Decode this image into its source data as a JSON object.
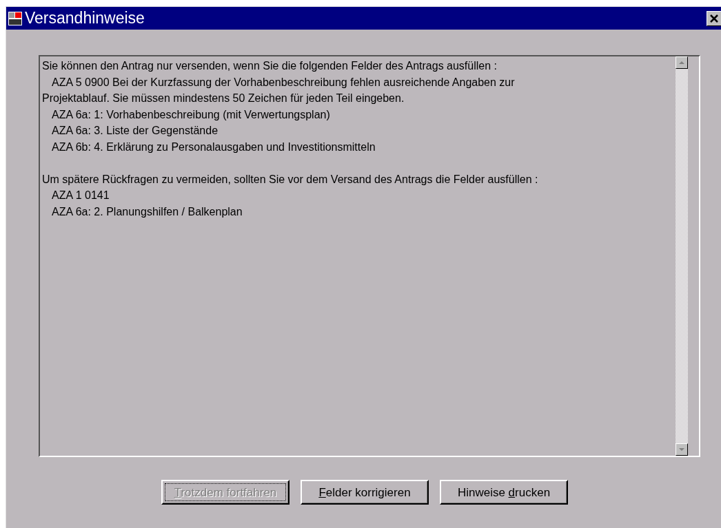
{
  "window": {
    "title": "Versandhinweise"
  },
  "message": {
    "sections": [
      {
        "lines": [
          {
            "text": "Sie können den Antrag nur versenden, wenn Sie die folgenden Felder des Antrags ausfüllen :",
            "indent": false
          },
          {
            "text": "AZA 5 0900 Bei der Kurzfassung der Vorhabenbeschreibung fehlen ausreichende Angaben zur",
            "indent": true
          },
          {
            "text": "Projektablauf. Sie müssen mindestens 50 Zeichen für jeden Teil eingeben.",
            "indent": false
          },
          {
            "text": "AZA 6a: 1: Vorhabenbeschreibung (mit Verwertungsplan)",
            "indent": true
          },
          {
            "text": "AZA 6a: 3. Liste der Gegenstände",
            "indent": true
          },
          {
            "text": "AZA 6b: 4. Erklärung zu Personalausgaben und Investitionsmitteln",
            "indent": true
          }
        ]
      },
      {
        "lines": [
          {
            "text": "Um spätere Rückfragen zu vermeiden, sollten Sie vor dem Versand des Antrags die Felder ausfüllen :",
            "indent": false
          },
          {
            "text": "AZA 1 0141",
            "indent": true
          },
          {
            "text": "AZA 6a: 2. Planungshilfen / Balkenplan",
            "indent": true
          }
        ]
      }
    ]
  },
  "buttons": [
    {
      "label_parts": [
        {
          "text": "T",
          "underlined": true
        },
        {
          "text": "rotzdem fortfahren",
          "underlined": false
        }
      ],
      "disabled": true,
      "focused": true
    },
    {
      "label_parts": [
        {
          "text": "F",
          "underlined": true
        },
        {
          "text": "elder korrigieren",
          "underlined": false
        }
      ],
      "disabled": false,
      "focused": false
    },
    {
      "label_parts": [
        {
          "text": "Hinweise ",
          "underlined": false
        },
        {
          "text": "d",
          "underlined": true
        },
        {
          "text": "rucken",
          "underlined": false
        }
      ],
      "disabled": false,
      "focused": false
    }
  ]
}
